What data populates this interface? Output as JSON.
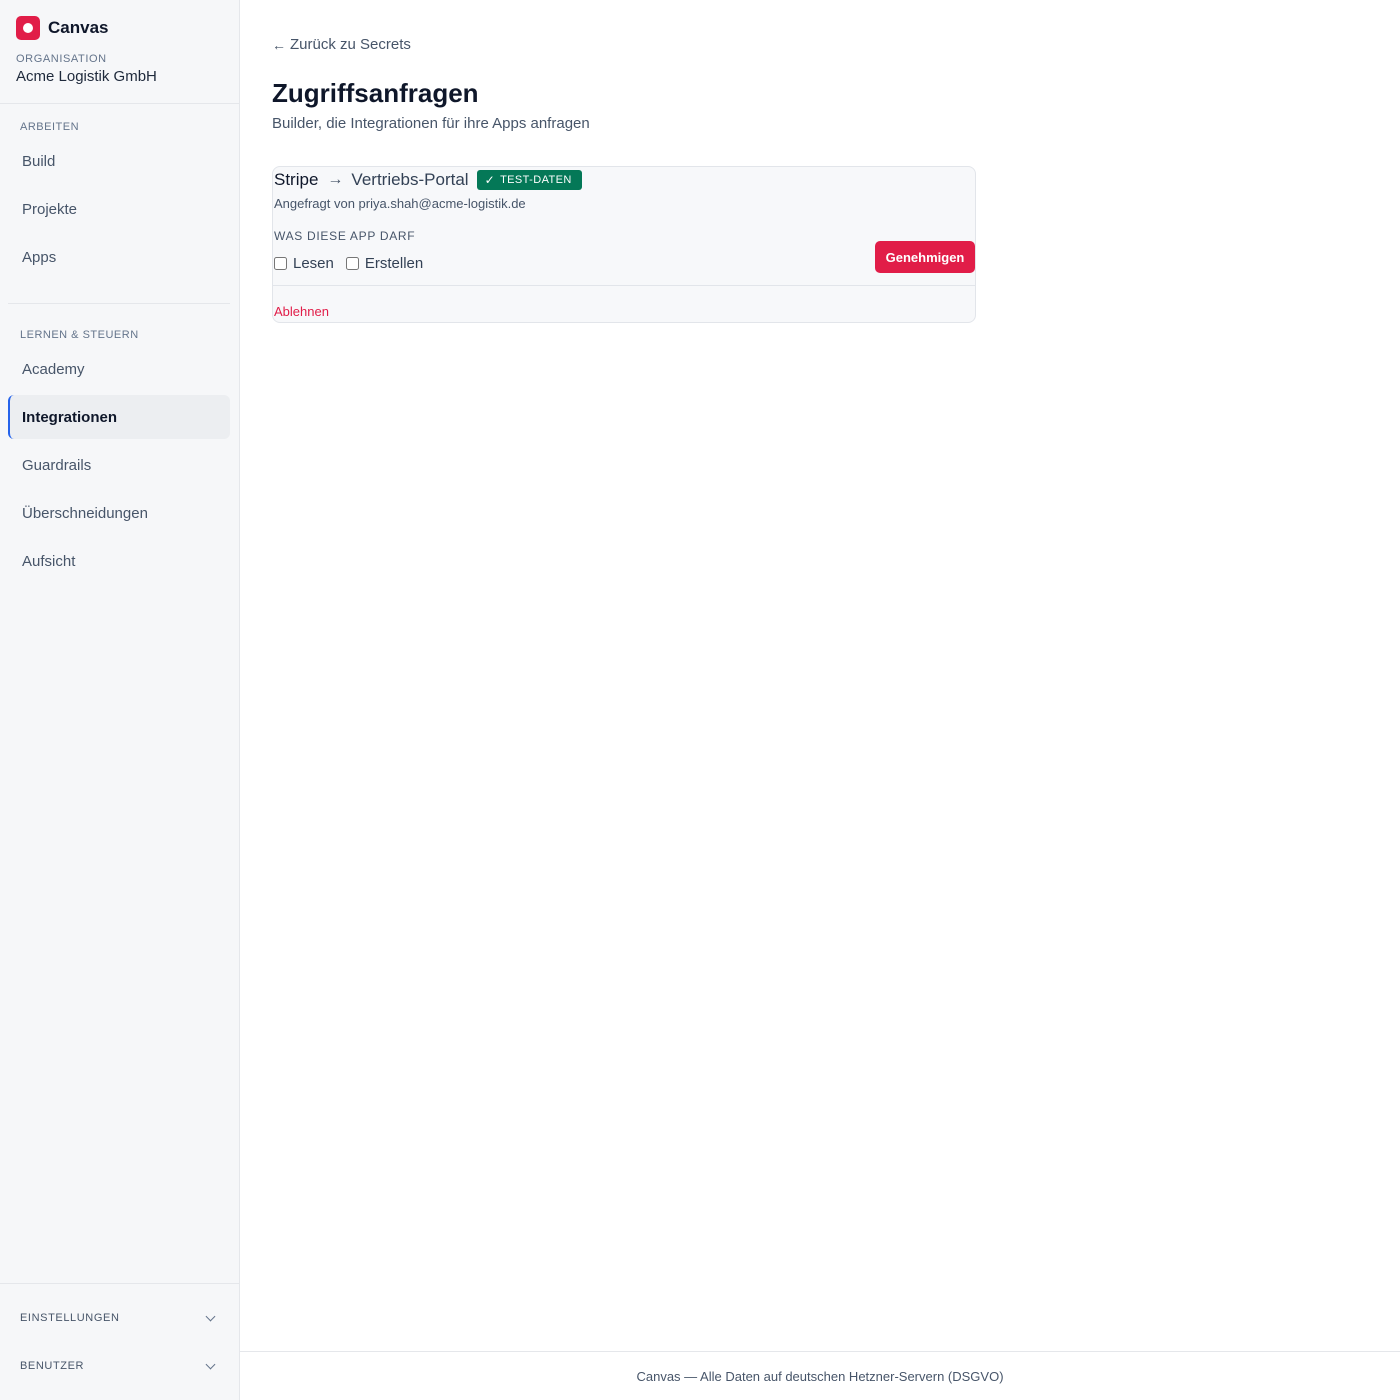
{
  "sidebar": {
    "brand": "Canvas",
    "org_label": "ORGANISATION",
    "org_name": "Acme Logistik GmbH",
    "sections": [
      {
        "label": "ARBEITEN",
        "items": [
          {
            "label": "Build"
          },
          {
            "label": "Projekte"
          },
          {
            "label": "Apps"
          }
        ]
      },
      {
        "label": "LERNEN & STEUERN",
        "items": [
          {
            "label": "Academy"
          },
          {
            "label": "Integrationen"
          },
          {
            "label": "Guardrails"
          },
          {
            "label": "Überschneidungen"
          },
          {
            "label": "Aufsicht"
          }
        ]
      }
    ],
    "active_item": "Integrationen",
    "collapsibles": [
      {
        "label": "EINSTELLUNGEN"
      },
      {
        "label": "BENUTZER"
      }
    ]
  },
  "main": {
    "back_link": "Zurück zu Secrets",
    "title": "Zugriffsanfragen",
    "subtitle": "Builder, die Integrationen für ihre Apps anfragen",
    "request": {
      "source": "Stripe",
      "target": "Vertriebs-Portal",
      "badge": "TEST-DATEN",
      "requested_by": "Angefragt von priya.shah@acme-logistik.de",
      "permissions_label": "WAS DIESE APP DARF",
      "permissions": [
        {
          "label": "Lesen",
          "checked": false
        },
        {
          "label": "Erstellen",
          "checked": false
        }
      ],
      "approve_label": "Genehmigen",
      "reject_label": "Ablehnen"
    }
  },
  "footer": {
    "text": "Canvas — Alle Daten auf deutschen Hetzner-Servern (DSGVO)"
  },
  "colors": {
    "accent": "#e11d48",
    "badge": "#047857",
    "sidebar_bg": "#f6f7f9"
  },
  "icons": [
    "logo-icon",
    "arrow-left-icon",
    "arrow-right-icon",
    "check-icon",
    "chevron-down-icon"
  ]
}
